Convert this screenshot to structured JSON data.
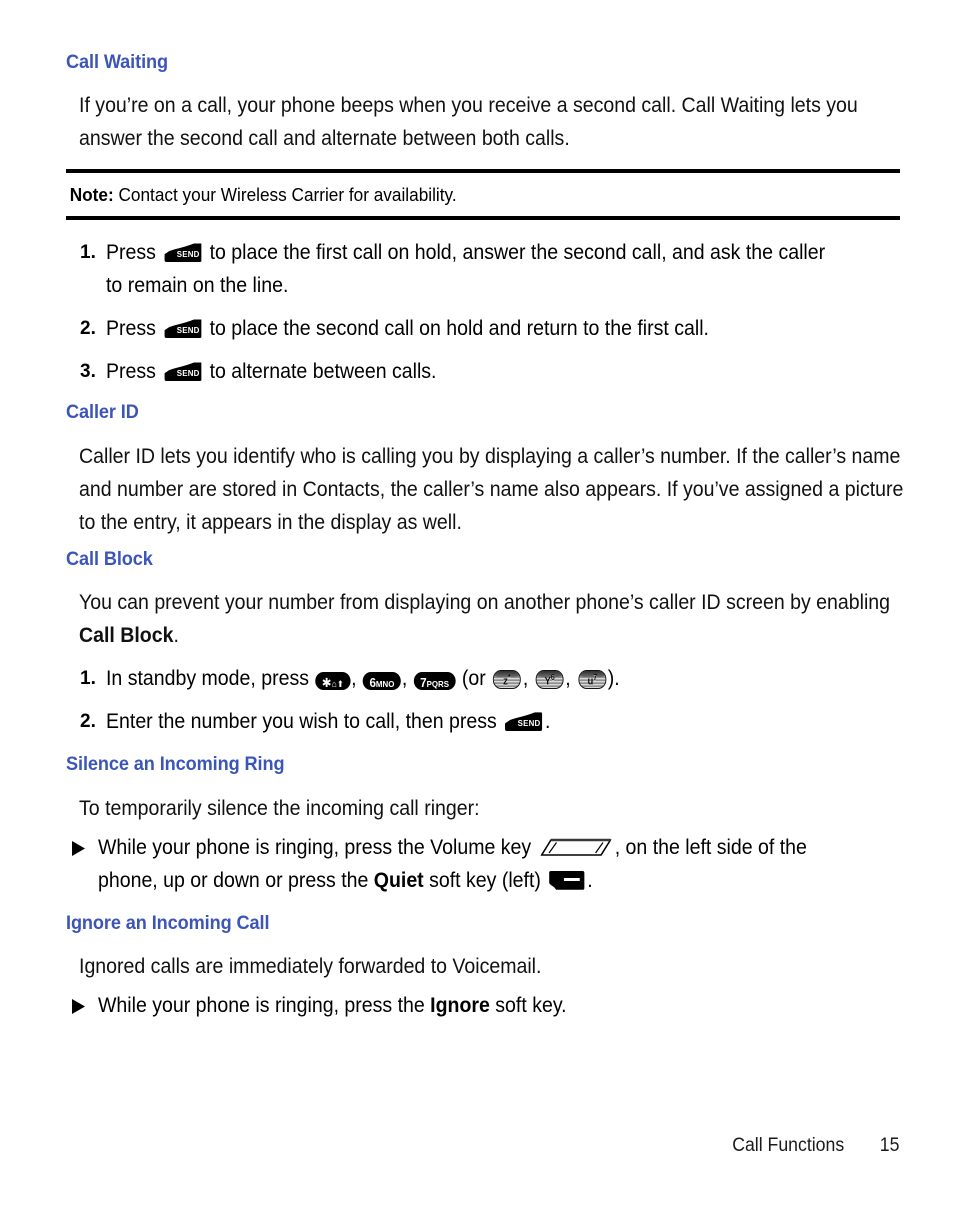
{
  "page": {
    "number": "15",
    "footer_section": "Call Functions"
  },
  "theme": {
    "heading_color": "#3b55b9",
    "body_color": "#111111",
    "rule_color": "#000000"
  },
  "sections": {
    "call_waiting": {
      "heading": "Call Waiting",
      "body": "If you’re on a call, your phone beeps when you receive a second call. Call Waiting lets you answer the second call and alternate between both calls.",
      "note_label": "Note:",
      "note_text": "Contact your Wireless Carrier for availability.",
      "steps": [
        {
          "number": "1.",
          "before": "Press",
          "key": "SEND",
          "after": "to place the first call on hold, answer the second call, and ask the caller to remain on the line."
        },
        {
          "number": "2.",
          "before": "Press",
          "key": "SEND",
          "after": "to place the second call on hold and return to the first call."
        },
        {
          "number": "3.",
          "before": "Press",
          "key": "SEND",
          "after": "to alternate between calls."
        }
      ]
    },
    "caller_id": {
      "heading": "Caller ID",
      "body": "Caller ID lets you identify who is calling you by displaying a caller’s number. If the caller’s name and number are stored in Contacts, the caller’s name also appears. If you’ve assigned a picture to the entry, it appears in the display as well."
    },
    "call_block": {
      "heading": "Call Block",
      "body_a": "You can prevent your number from displaying on another phone’s caller ID screen by enabling ",
      "body_bold": "Call Block",
      "body_b": ".",
      "step1": {
        "number": "1.",
        "before": "In standby mode, press",
        "keys_black": [
          {
            "main": "✱",
            "glyph": "⌂⬆",
            "sub": ""
          },
          {
            "main": "6",
            "glyph": "",
            "sub": "MNO"
          },
          {
            "main": "7",
            "glyph": "",
            "sub": "PQRS"
          }
        ],
        "or_text": "(or",
        "keys_grey": [
          {
            "letter": "z",
            "sup": "*"
          },
          {
            "letter": "Y",
            "sup": "6"
          },
          {
            "letter": "u",
            "sup": "7"
          }
        ],
        "close": ")."
      },
      "step2": {
        "number": "2.",
        "before": "Enter the number you wish to call, then press",
        "key": "SEND",
        "after": "."
      }
    },
    "silence_ring": {
      "heading": "Silence an Incoming Ring",
      "intro": "To temporarily silence the incoming call ringer:",
      "bullet": {
        "part_a": "While your phone is ringing, press the Volume key",
        "part_b": ", on the left side of the phone, up or down or press the ",
        "bold": "Quiet",
        "part_c": " soft key (left)",
        "part_d": "."
      }
    },
    "ignore_call": {
      "heading": "Ignore an Incoming Call",
      "intro": "Ignored calls are immediately forwarded to Voicemail.",
      "bullet": {
        "part_a": "While your phone is ringing, press the ",
        "bold": "Ignore",
        "part_b": " soft key."
      }
    }
  },
  "icons": {
    "send_key": "send-key-icon",
    "soft_key": "soft-key-icon",
    "volume_key": "volume-key-icon",
    "bullet": "triangle-bullet-icon"
  }
}
